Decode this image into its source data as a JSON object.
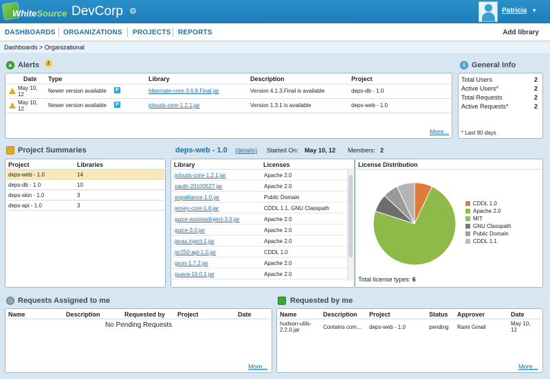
{
  "header": {
    "logo_part1": "White",
    "logo_part2": "Source",
    "org_name": "DevCorp",
    "user_name": "Patricia"
  },
  "nav": {
    "items": [
      "DASHBOARDS",
      "ORGANIZATIONS",
      "PROJECTS",
      "REPORTS"
    ],
    "add_library": "Add library"
  },
  "breadcrumb": "Dashboards > Organizational",
  "alerts": {
    "title": "Alerts",
    "count": "2",
    "columns": [
      "Date",
      "Type",
      "Library",
      "Description",
      "Project"
    ],
    "rows": [
      {
        "date1": "May 10,",
        "date2": "12",
        "type": "Newer version available",
        "badge": "P",
        "library": "hibernate-core-3.6.8.Final.jar",
        "description": "Version 4.1.3.Final is available",
        "project": "deps-db - 1.0"
      },
      {
        "date1": "May 10,",
        "date2": "12",
        "type": "Newer version available",
        "badge": "P",
        "library": "jclouds-core-1.2.1.jar",
        "description": "Version 1.3.1 is available",
        "project": "deps-web - 1.0"
      }
    ],
    "more": "More..."
  },
  "general_info": {
    "title": "General Info",
    "rows": [
      {
        "label": "Total Users",
        "value": "2"
      },
      {
        "label": "Active Users*",
        "value": "2"
      },
      {
        "label": "Total Requests",
        "value": "2"
      },
      {
        "label": "Active Requests*",
        "value": "2"
      }
    ],
    "footnote": "* Last 90 days"
  },
  "project_summaries": {
    "title": "Project Summaries",
    "columns": [
      "Project",
      "Libraries"
    ],
    "rows": [
      {
        "project": "deps-web - 1.0",
        "libraries": "14"
      },
      {
        "project": "deps-db - 1.0",
        "libraries": "10"
      },
      {
        "project": "deps-skin - 1.0",
        "libraries": "3"
      },
      {
        "project": "deps-api - 1.0",
        "libraries": "3"
      }
    ]
  },
  "project_detail": {
    "name": "deps-web - 1.0",
    "details_link": "(details)",
    "started_label": "Started On:",
    "started_value": "May 10, 12",
    "members_label": "Members:",
    "members_value": "2",
    "columns": [
      "Library",
      "Licenses"
    ],
    "rows": [
      {
        "library": "jclouds-core-1.2.1.jar",
        "license": "Apache 2.0"
      },
      {
        "library": "oauth-20100527.jar",
        "license": "Apache 2.0"
      },
      {
        "library": "aopalliance-1.0.jar",
        "license": "Public Domain"
      },
      {
        "library": "jersey-core-1.6.jar",
        "license": "CDDL 1.1, GNU Classpath"
      },
      {
        "library": "guice-assistedinject-3.0.jar",
        "license": "Apache 2.0"
      },
      {
        "library": "guice-3.0.jar",
        "license": "Apache 2.0"
      },
      {
        "library": "javax.inject-1.jar",
        "license": "Apache 2.0"
      },
      {
        "library": "jsr250-api-1.0.jar",
        "license": "CDDL 1.0"
      },
      {
        "library": "gson-1.7.2.jar",
        "license": "Apache 2.0"
      },
      {
        "library": "guava-10.0.1.jar",
        "license": "Apache 2.0"
      }
    ]
  },
  "license_distribution": {
    "title": "License Distribution",
    "total_label": "Total license types:",
    "total_value": "6"
  },
  "chart_data": {
    "type": "pie",
    "title": "License Distribution",
    "categories": [
      "CDDL 1.0",
      "Apache 2.0",
      "MIT",
      "GNU Classpath",
      "Public Domain",
      "CDDL 1.1"
    ],
    "values": [
      7,
      0,
      73,
      7,
      6,
      7
    ],
    "colors": [
      "#e07b39",
      "#8dba48",
      "#8dba48",
      "#6e6e6e",
      "#9a9a9a",
      "#b4b4b4"
    ],
    "legend_colors": [
      "#e07b39",
      "#8dba48",
      "#9ac04c",
      "#7a7a7a",
      "#a0a0a0",
      "#bdbdbd"
    ],
    "legend": "right"
  },
  "requests_assigned": {
    "title": "Requests Assigned to me",
    "columns": [
      "Name",
      "Description",
      "Requested by",
      "Project",
      "Date"
    ],
    "empty": "No Pending Requests",
    "more": "More..."
  },
  "requested_by": {
    "title": "Requested by me",
    "columns": [
      "Name",
      "Description",
      "Project",
      "Status",
      "Approver",
      "Date"
    ],
    "rows": [
      {
        "name1": "hudson-utils-",
        "name2": "2.2.0.jar",
        "description": "Contains com...",
        "project": "deps-web - 1.0",
        "status": "pending",
        "approver": "Rami Gmail",
        "date1": "May 10,",
        "date2": "12"
      }
    ],
    "more": "More..."
  }
}
